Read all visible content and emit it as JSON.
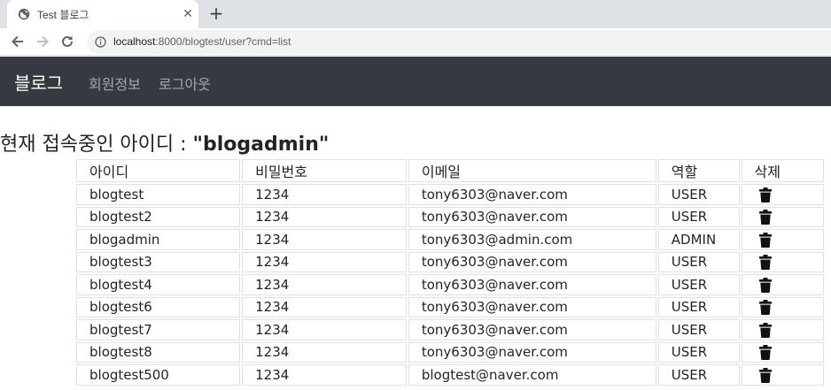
{
  "browser": {
    "tab_title": "Test 블로그",
    "new_tab_label": "+",
    "close_label": "✕",
    "url_host": "localhost",
    "url_path": ":8000/blogtest/user?cmd=list"
  },
  "navbar": {
    "brand": "블로그",
    "links": [
      "회원정보",
      "로그아웃"
    ]
  },
  "heading": {
    "prefix": "현재 접속중인 아이디 : ",
    "user": "\"blogadmin\""
  },
  "table": {
    "headers": [
      "아이디",
      "비밀번호",
      "이메일",
      "역할",
      "삭제"
    ],
    "rows": [
      {
        "id": "blogtest",
        "password": "1234",
        "email": "tony6303@naver.com",
        "role": "USER"
      },
      {
        "id": "blogtest2",
        "password": "1234",
        "email": "tony6303@naver.com",
        "role": "USER"
      },
      {
        "id": "blogadmin",
        "password": "1234",
        "email": "tony6303@admin.com",
        "role": "ADMIN"
      },
      {
        "id": "blogtest3",
        "password": "1234",
        "email": "tony6303@naver.com",
        "role": "USER"
      },
      {
        "id": "blogtest4",
        "password": "1234",
        "email": "tony6303@naver.com",
        "role": "USER"
      },
      {
        "id": "blogtest6",
        "password": "1234",
        "email": "tony6303@naver.com",
        "role": "USER"
      },
      {
        "id": "blogtest7",
        "password": "1234",
        "email": "tony6303@naver.com",
        "role": "USER"
      },
      {
        "id": "blogtest8",
        "password": "1234",
        "email": "tony6303@naver.com",
        "role": "USER"
      },
      {
        "id": "blogtest500",
        "password": "1234",
        "email": "blogtest@naver.com",
        "role": "USER"
      }
    ],
    "delete_icon": "trash-icon"
  },
  "colors": {
    "navbar_bg": "#343a40",
    "border": "#dee2e6"
  }
}
